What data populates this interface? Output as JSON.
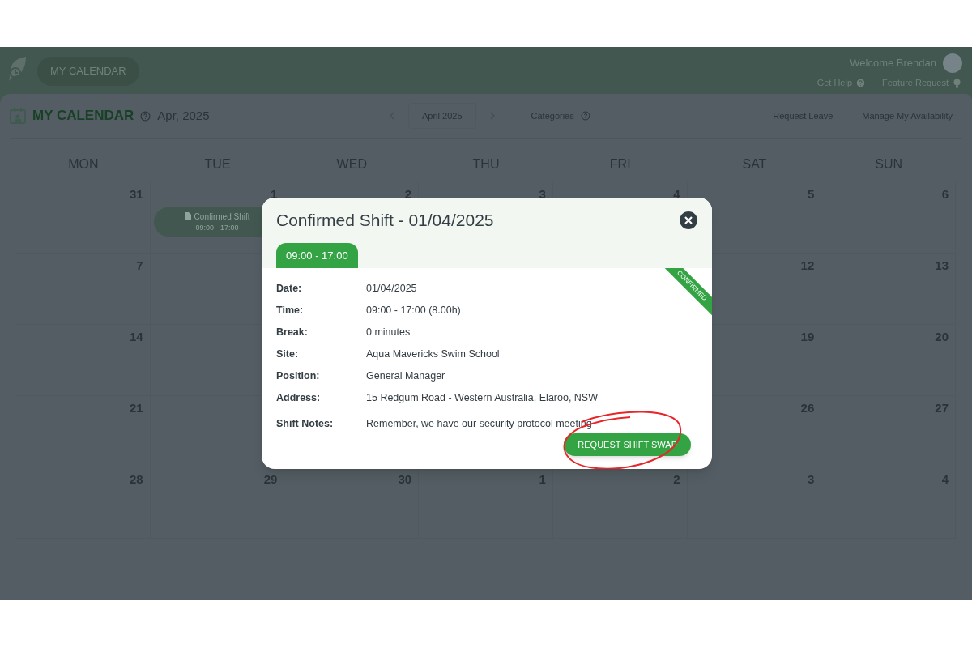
{
  "header": {
    "app_button": "MY CALENDAR",
    "welcome": "Welcome Brendan",
    "links": [
      {
        "label": "Get Help",
        "kind": "help"
      },
      {
        "label": "Feature Request",
        "kind": "idea"
      }
    ]
  },
  "toolbar": {
    "title": "MY CALENDAR",
    "period": "Apr, 2025",
    "month": "April 2025",
    "categories": "Categories",
    "actions": [
      "Request Leave",
      "Manage My Availability"
    ]
  },
  "calendar": {
    "weekdays": [
      "MON",
      "TUE",
      "WED",
      "THU",
      "FRI",
      "SAT",
      "SUN"
    ],
    "weeks": [
      [
        {
          "day": "31"
        },
        {
          "day": "1",
          "event": {
            "title": "Confirmed Shift",
            "time": "09:00 - 17:00"
          }
        },
        {
          "day": "2"
        },
        {
          "day": "3"
        },
        {
          "day": "4"
        },
        {
          "day": "5"
        },
        {
          "day": "6"
        }
      ],
      [
        {
          "day": "7"
        },
        {
          "day": "12"
        },
        {
          "day": "13"
        }
      ],
      [
        {
          "day": "14"
        },
        {
          "day": "19"
        },
        {
          "day": "20"
        }
      ],
      [
        {
          "day": "21"
        },
        {
          "day": "26"
        },
        {
          "day": "27"
        }
      ],
      [
        {
          "day": "28"
        },
        {
          "day": "29"
        },
        {
          "day": "30"
        },
        {
          "day": "1"
        },
        {
          "day": "2"
        },
        {
          "day": "3"
        },
        {
          "day": "4"
        }
      ]
    ]
  },
  "modal": {
    "title": "Confirmed Shift - 01/04/2025",
    "tab": "09:00 - 17:00",
    "ribbon": "CONFIRMED",
    "fields": [
      {
        "label": "Date:",
        "value": "01/04/2025"
      },
      {
        "label": "Time:",
        "value": "09:00 - 17:00 (8.00h)"
      },
      {
        "label": "Break:",
        "value": "0 minutes"
      },
      {
        "label": "Site:",
        "value": "Aqua Mavericks Swim School"
      },
      {
        "label": "Position:",
        "value": "General Manager"
      },
      {
        "label": "Address:",
        "value": "15 Redgum Road - Western Australia, Elaroo, NSW"
      },
      {
        "label": "Shift Notes:",
        "value": "Remember, we have our security protocol meeting"
      }
    ],
    "button": "REQUEST SHIFT SWAP"
  }
}
